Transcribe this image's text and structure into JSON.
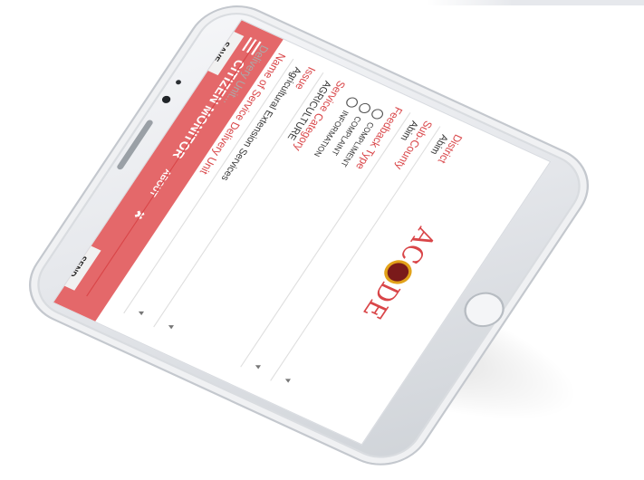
{
  "app": {
    "title": "CITIZEN MONITOR",
    "about_label": "ABOUT",
    "user_icon": "user-icon",
    "menu_icon": "menu-icon",
    "logo_text_left": "AC",
    "logo_text_right": "DE"
  },
  "form": {
    "district": {
      "label": "District",
      "value": "Abim"
    },
    "subcounty": {
      "label": "Sub-County",
      "value": "Abim"
    },
    "feedback_type": {
      "label": "Feedback Type",
      "options": [
        "COMPLIMENT",
        "COMPLAINT",
        "INFORMATION"
      ]
    },
    "service_category": {
      "label": "Service Category",
      "value": "AGRICULTURE"
    },
    "issue": {
      "label": "Issue",
      "value": "Agricultural Extension Services"
    },
    "delivery_unit": {
      "label": "Name of Service Delivery Unit",
      "placeholder": "Delivery Unit..."
    },
    "save_label": "SAVE",
    "send_label": "SEND"
  },
  "colors": {
    "accent": "#e4686a",
    "label": "#d94548",
    "logo_ring": "#e2a21a"
  }
}
